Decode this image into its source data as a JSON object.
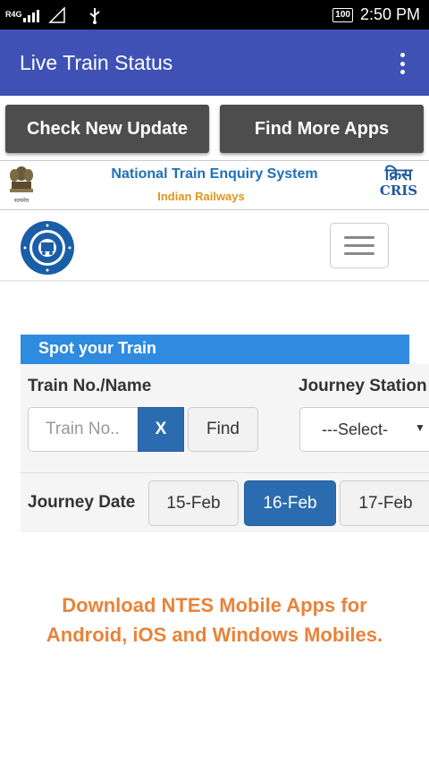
{
  "status_bar": {
    "network": "R4G",
    "battery": "100",
    "time": "2:50 PM"
  },
  "app_bar": {
    "title": "Live Train Status"
  },
  "actions": {
    "check_update": "Check New Update",
    "find_apps": "Find More Apps"
  },
  "banner": {
    "title": "National Train Enquiry System",
    "subtitle": "Indian Railways",
    "cris_hindi": "क्रिस",
    "cris_en": "CRIS"
  },
  "spot_train": {
    "header": "Spot your Train",
    "train_label": "Train No./Name",
    "train_placeholder": "Train No..",
    "clear_label": "X",
    "find_label": "Find",
    "station_label": "Journey Station",
    "station_selected": "---Select-",
    "date_label": "Journey Date",
    "dates": [
      "15-Feb",
      "16-Feb",
      "17-Feb"
    ],
    "selected_date": "16-Feb"
  },
  "download": {
    "message": "Download NTES Mobile Apps for Android, iOS and Windows Mobiles."
  },
  "colors": {
    "app_bar": "#3f51b5",
    "action_button": "#4d4d4d",
    "panel_header": "#2f8be0",
    "primary_button": "#2b6cb0",
    "download_text": "#e8833a"
  }
}
